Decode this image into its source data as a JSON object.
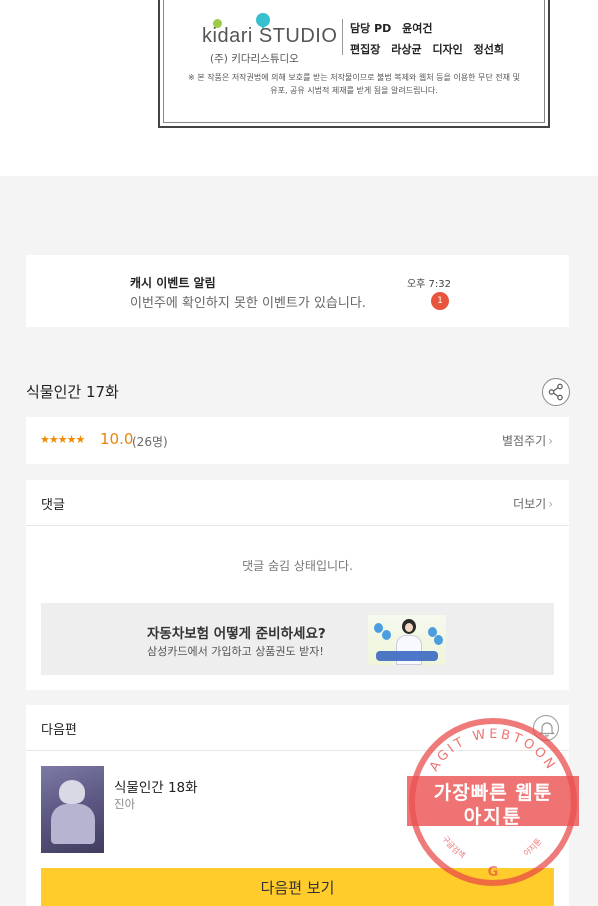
{
  "credits": {
    "brand_text": "kidari STUDIO",
    "corp_name": "(주) 키다리스튜디오",
    "roles_row1": [
      "담당 PD",
      "윤여건"
    ],
    "roles_row2": [
      "편집장",
      "라상균",
      "디자인",
      "정선희"
    ],
    "copyright": "※ 본 작품은 저작권법에 의해 보호를 받는 저작물이므로 불법 복제와 웹처 등을 이용한 무단 전재 및 유포, 공유 시법적 제재를 받게 됨을 알려드립니다."
  },
  "notice": {
    "title": "캐시 이벤트 알림",
    "message": "이번주에 확인하지 못한 이벤트가 있습니다.",
    "time": "오후 7:32",
    "badge": "1"
  },
  "episode": {
    "title": "식물인간 17화",
    "share_icon": "share-icon"
  },
  "rating": {
    "stars": "★★★★★",
    "score": "10.0",
    "score_value": 10.0,
    "count": "(26명)",
    "rate_label": "별점주기"
  },
  "comments": {
    "label": "댓글",
    "more_label": "더보기",
    "hidden_message": "댓글 숨김 상태입니다."
  },
  "ad": {
    "title": "자동차보험 어떻게 준비하세요?",
    "subtitle": "삼성카드에서 가입하고 상품권도 받자!"
  },
  "next_episode": {
    "label": "다음편",
    "title": "식물인간 18화",
    "author": "진아",
    "button_label": "다음편 보기",
    "bell_icon": "bell-icon"
  },
  "watermark": {
    "arc_text": "AGIT WEBTOON",
    "line1": "가장빠른 웹툰",
    "line2": "아지툰",
    "bottom_left": "구글검색",
    "bottom_right": "아지툰",
    "bottom_icon": "G"
  },
  "colors": {
    "accent_yellow": "#ffcc2b",
    "rating_orange": "#e9840c",
    "badge_red": "#e8553d",
    "stamp_red": "#e84646"
  }
}
